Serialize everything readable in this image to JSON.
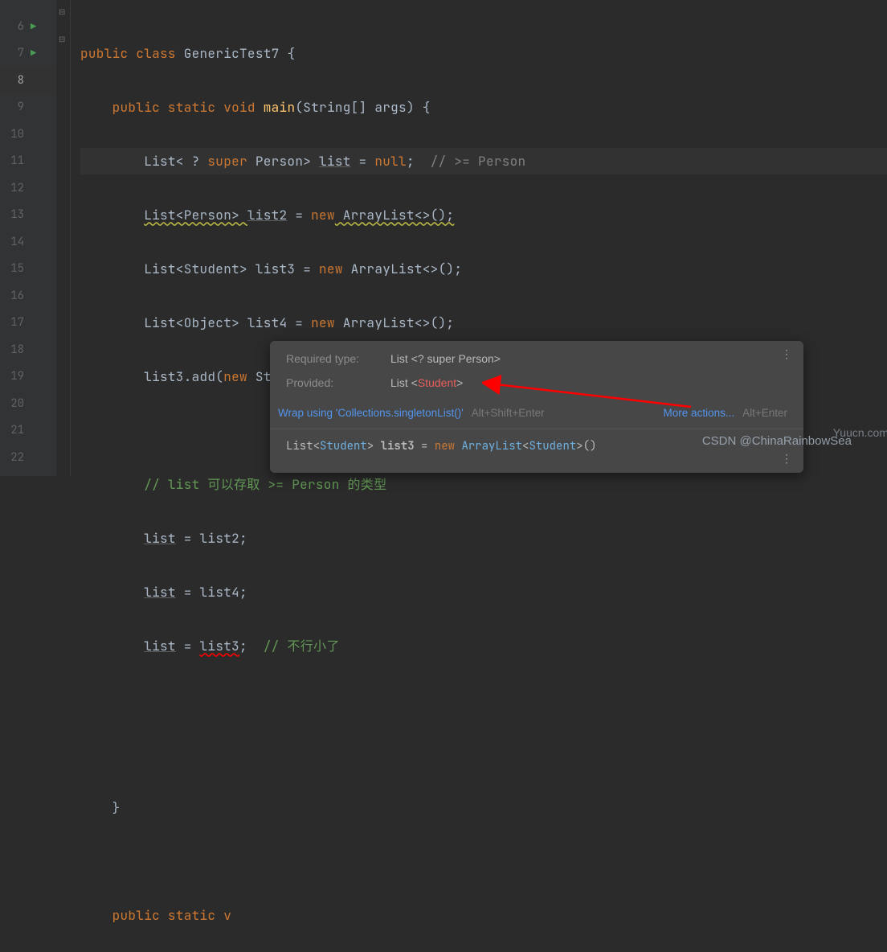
{
  "gutter": {
    "lines": [
      "6",
      "7",
      "8",
      "9",
      "10",
      "11",
      "12",
      "13",
      "14",
      "15",
      "16",
      "17",
      "18",
      "19",
      "20",
      "21",
      "22"
    ],
    "active_index": 2
  },
  "code": {
    "l6": {
      "kw1": "public",
      "kw2": "class",
      "name": "GenericTest7",
      "brace": "{"
    },
    "l7": {
      "kw1": "public",
      "kw2": "static",
      "kw3": "void",
      "fn": "main",
      "args": "(String[] args)",
      "brace": "{"
    },
    "l8": {
      "t1": "List< ? ",
      "kw": "super",
      "t2": " Person> ",
      "var": "list",
      "t3": " = ",
      "null": "null",
      "t4": ";  ",
      "c": "// >= Person"
    },
    "l9": {
      "t1": "List<Person> ",
      "var": "list2",
      "t2": " = ",
      "kw": "new",
      "t3": " ArrayList<>();"
    },
    "l10": {
      "t1": "List<Student> list3 = ",
      "kw": "new",
      "t2": " ArrayList<>();"
    },
    "l11": {
      "t1": "List<Object> list4 = ",
      "kw": "new",
      "t2": " ArrayList<>();"
    },
    "l12": {
      "t1": "list3.add(",
      "kw": "new",
      "t2": " Student() );"
    },
    "l14": {
      "c": "// list 可以存取 >= Person 的类型"
    },
    "l15": {
      "var": "list",
      "t": " = list2;"
    },
    "l16": {
      "var": "list",
      "t": " = list4;"
    },
    "l17": {
      "var": "list",
      "t1": " = ",
      "err": "list3",
      "t2": ";  ",
      "c": "// 不行小了"
    },
    "l20": {
      "brace": "}"
    },
    "l22": {
      "kw1": "public",
      "kw2": "static",
      "kw3": "v"
    }
  },
  "tooltip": {
    "required_label": "Required type:",
    "required_val": "List <? super Person>",
    "provided_label": "Provided:",
    "provided_val_pre": "List <",
    "provided_val_bad": "Student",
    "provided_val_post": ">",
    "fix": "Wrap using 'Collections.singletonList()'",
    "fix_hint": "Alt+Shift+Enter",
    "more": "More actions...",
    "more_hint": "Alt+Enter",
    "footer": {
      "pre": "List<",
      "cls1": "Student",
      "mid": "> ",
      "b": "list3",
      "eq": " = ",
      "kw": "new ",
      "cls2": "ArrayList",
      "lt": "<",
      "cls3": "Student",
      "gt": ">()"
    }
  },
  "watermark": "CSDN @ChinaRainbowSea",
  "watermark2": "Yuucn.com"
}
